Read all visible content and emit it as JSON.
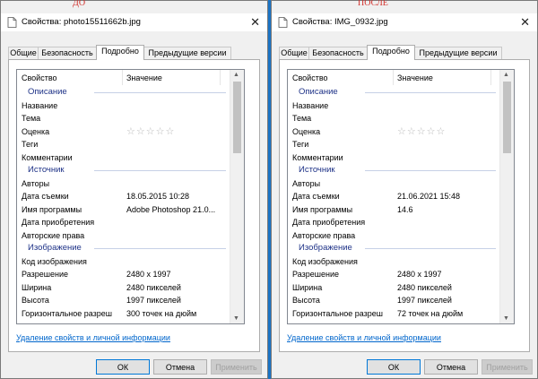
{
  "tabs": [
    "Общие",
    "Безопасность",
    "Подробно",
    "Предыдущие версии"
  ],
  "header": {
    "col_property": "Свойство",
    "col_value": "Значение"
  },
  "rating_stars": "☆☆☆☆☆",
  "link_text": "Удаление свойств и личной информации",
  "buttons": {
    "ok": "ОК",
    "cancel": "Отмена",
    "apply": "Применить"
  },
  "close_glyph": "✕",
  "colors": {
    "group_heading": "#1e3287",
    "link": "#0066cc",
    "caption": "#d2312c"
  },
  "left": {
    "caption": "ДО",
    "title": "Свойства: photo15511662b.jpg",
    "groups": {
      "description": "Описание",
      "source": "Источник",
      "image": "Изображение"
    },
    "rows": {
      "name": "Название",
      "theme": "Тема",
      "rating": "Оценка",
      "tags": "Теги",
      "comments": "Комментарии",
      "authors": "Авторы",
      "date_taken": "Дата съемки",
      "date_taken_val": "18.05.2015 10:28",
      "program": "Имя программы",
      "program_val": "Adobe Photoshop 21.0...",
      "acquired": "Дата приобретения",
      "copyright": "Авторские права",
      "image_id": "Код изображения",
      "resolution": "Разрешение",
      "resolution_val": "2480 x 1997",
      "width": "Ширина",
      "width_val": "2480 пикселей",
      "height": "Высота",
      "height_val": "1997 пикселей",
      "hres": "Горизонтальное разреш",
      "hres_val": "300 точек на дюйм"
    }
  },
  "right": {
    "caption": "ПОСЛЕ",
    "title": "Свойства: IMG_0932.jpg",
    "groups": {
      "description": "Описание",
      "source": "Источник",
      "image": "Изображение"
    },
    "rows": {
      "name": "Название",
      "theme": "Тема",
      "rating": "Оценка",
      "tags": "Теги",
      "comments": "Комментарии",
      "authors": "Авторы",
      "date_taken": "Дата съемки",
      "date_taken_val": "21.06.2021 15:48",
      "program": "Имя программы",
      "program_val": "14.6",
      "acquired": "Дата приобретения",
      "copyright": "Авторские права",
      "image_id": "Код изображения",
      "resolution": "Разрешение",
      "resolution_val": "2480 x 1997",
      "width": "Ширина",
      "width_val": "2480 пикселей",
      "height": "Высота",
      "height_val": "1997 пикселей",
      "hres": "Горизонтальное разреш",
      "hres_val": "72 точек на дюйм"
    }
  }
}
